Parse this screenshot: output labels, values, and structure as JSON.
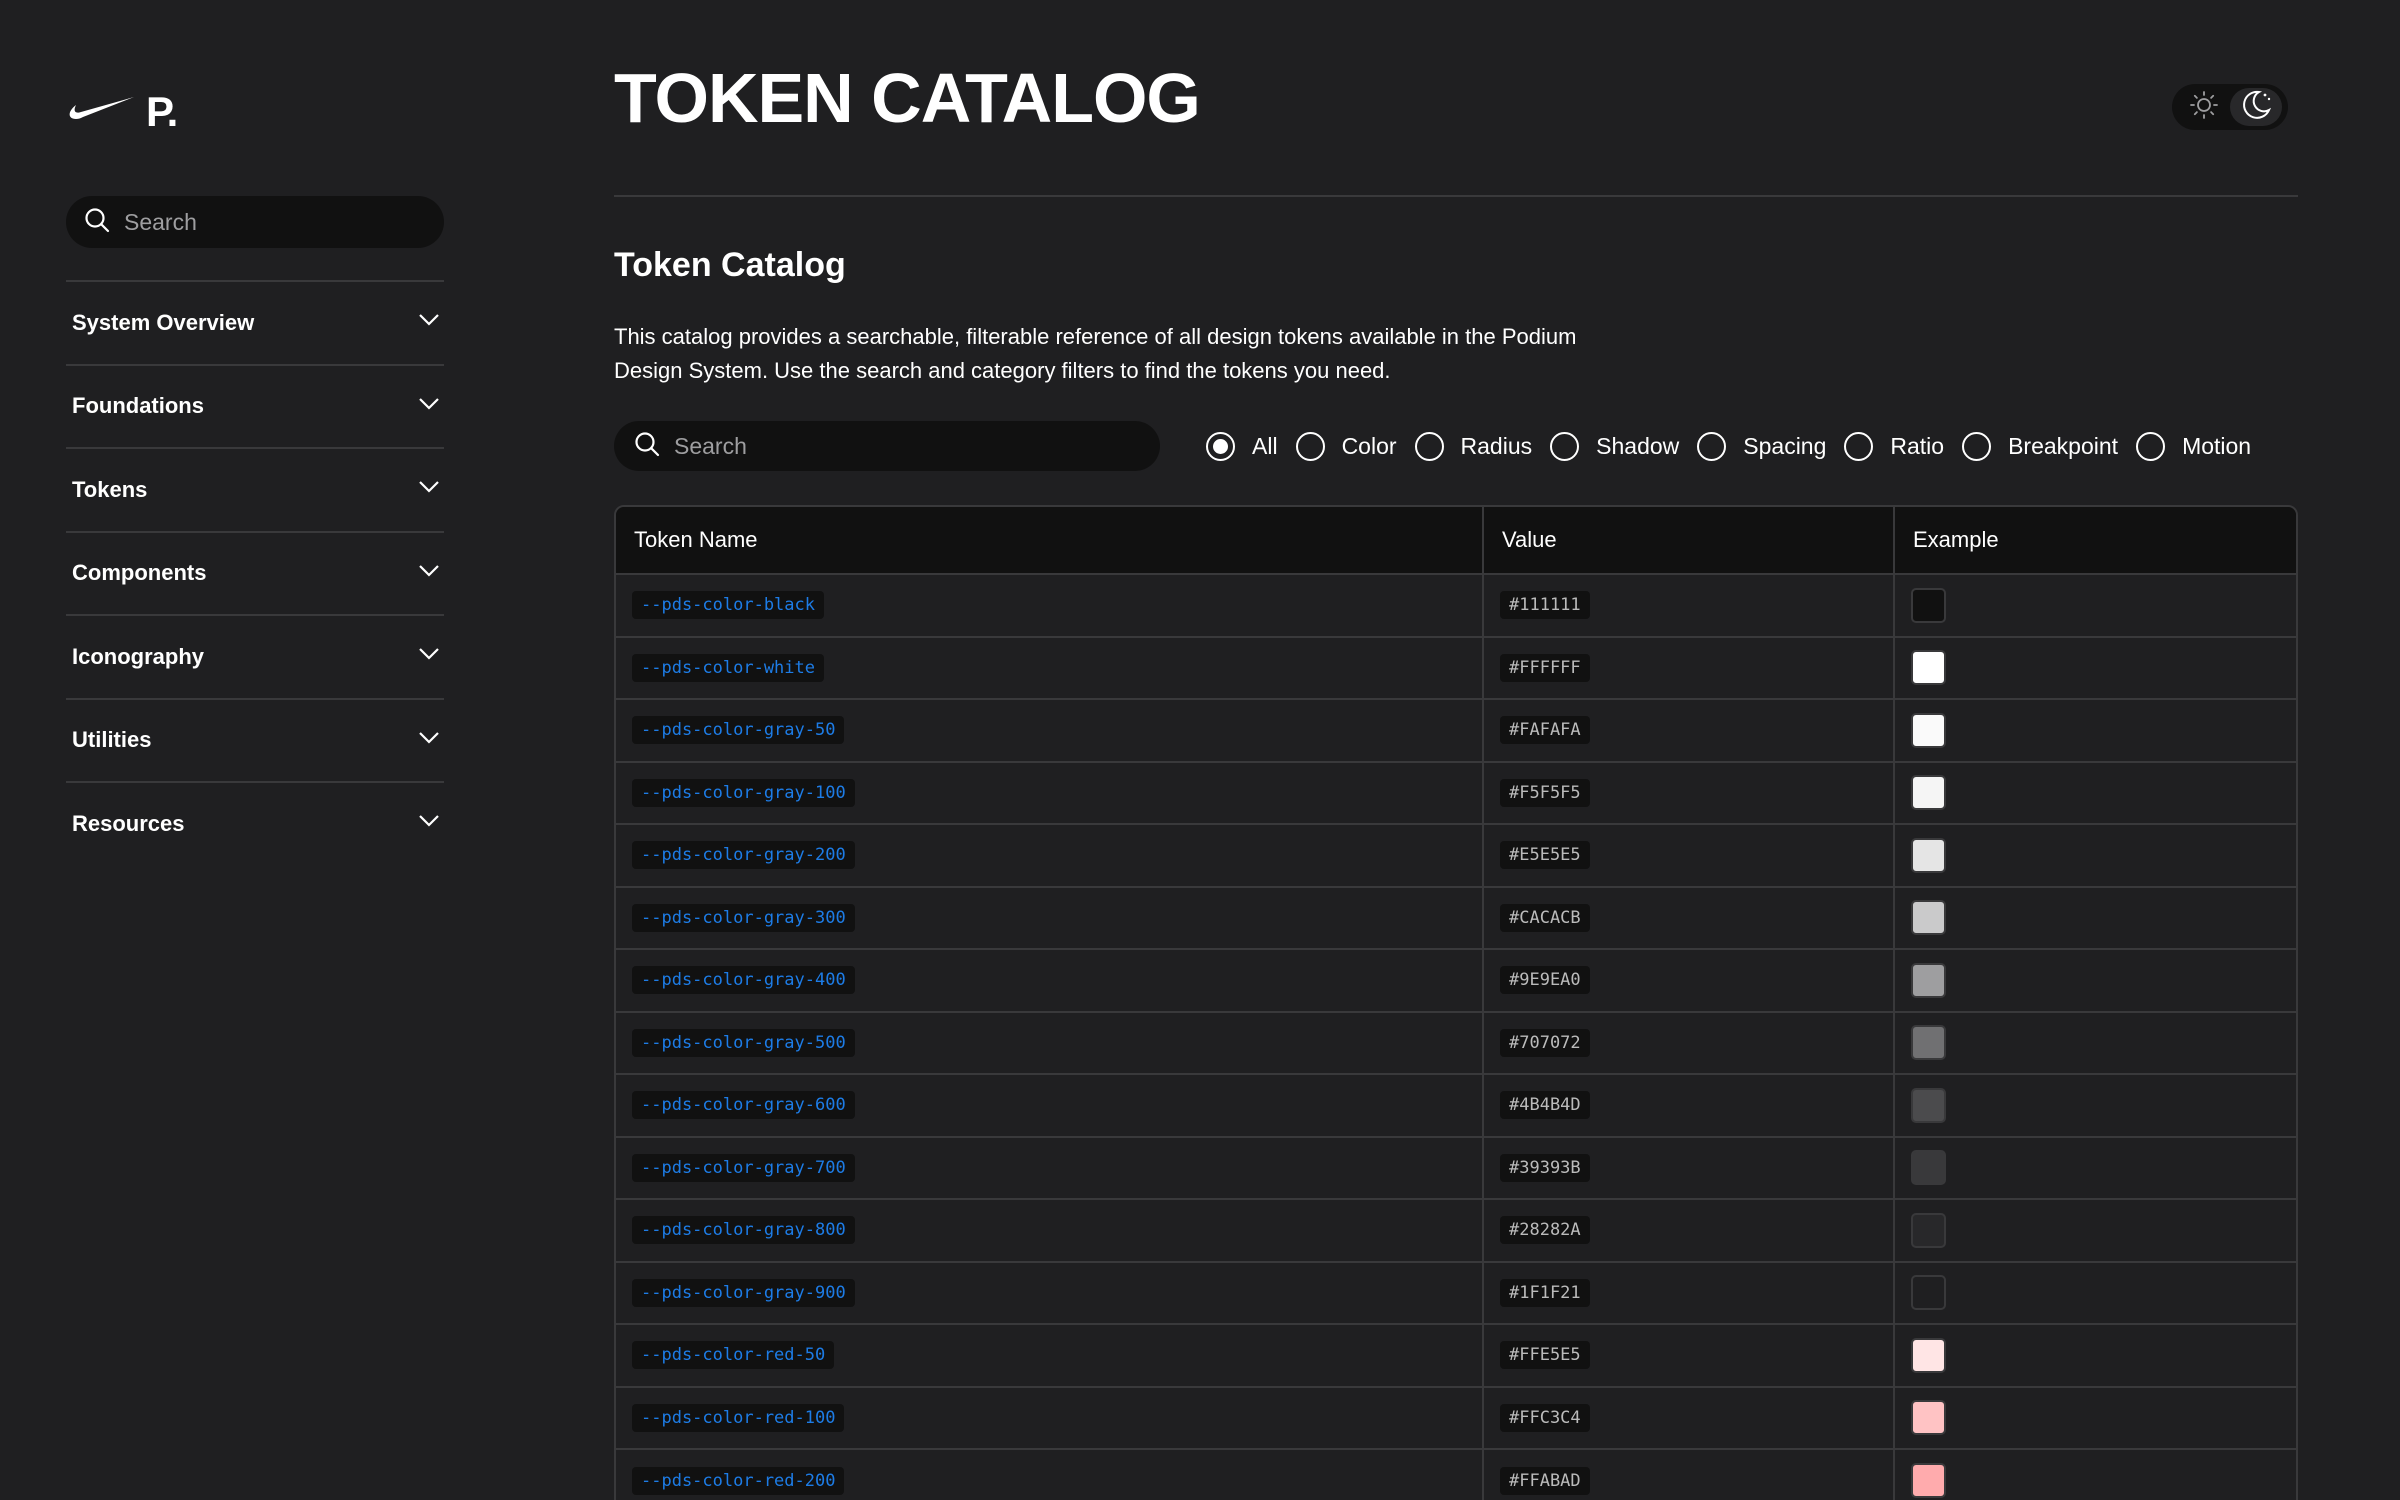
{
  "brand": {
    "logo_letter": "P."
  },
  "sidebar": {
    "search_placeholder": "Search",
    "items": [
      {
        "label": "System Overview"
      },
      {
        "label": "Foundations"
      },
      {
        "label": "Tokens"
      },
      {
        "label": "Components"
      },
      {
        "label": "Iconography"
      },
      {
        "label": "Utilities"
      },
      {
        "label": "Resources"
      }
    ]
  },
  "header": {
    "title": "TOKEN CATALOG",
    "theme": "dark"
  },
  "section": {
    "title": "Token Catalog",
    "description": "This catalog provides a searchable, filterable reference of all design tokens available in the Podium Design System. Use the search and category filters to find the tokens you need."
  },
  "filters": {
    "search_placeholder": "Search",
    "selected": "All",
    "options": [
      "All",
      "Color",
      "Radius",
      "Shadow",
      "Spacing",
      "Ratio",
      "Breakpoint",
      "Motion"
    ]
  },
  "table": {
    "headers": [
      "Token Name",
      "Value",
      "Example"
    ],
    "rows": [
      {
        "name": "--pds-color-black",
        "value": "#111111"
      },
      {
        "name": "--pds-color-white",
        "value": "#FFFFFF"
      },
      {
        "name": "--pds-color-gray-50",
        "value": "#FAFAFA"
      },
      {
        "name": "--pds-color-gray-100",
        "value": "#F5F5F5"
      },
      {
        "name": "--pds-color-gray-200",
        "value": "#E5E5E5"
      },
      {
        "name": "--pds-color-gray-300",
        "value": "#CACACB"
      },
      {
        "name": "--pds-color-gray-400",
        "value": "#9E9EA0"
      },
      {
        "name": "--pds-color-gray-500",
        "value": "#707072"
      },
      {
        "name": "--pds-color-gray-600",
        "value": "#4B4B4D"
      },
      {
        "name": "--pds-color-gray-700",
        "value": "#39393B"
      },
      {
        "name": "--pds-color-gray-800",
        "value": "#28282A"
      },
      {
        "name": "--pds-color-gray-900",
        "value": "#1F1F21"
      },
      {
        "name": "--pds-color-red-50",
        "value": "#FFE5E5"
      },
      {
        "name": "--pds-color-red-100",
        "value": "#FFC3C4"
      },
      {
        "name": "--pds-color-red-200",
        "value": "#FFABAD"
      }
    ]
  },
  "colors": {
    "background": "#1f1f21",
    "surface": "#111111",
    "accent": "#1d7ce6",
    "border": "#39393b"
  }
}
